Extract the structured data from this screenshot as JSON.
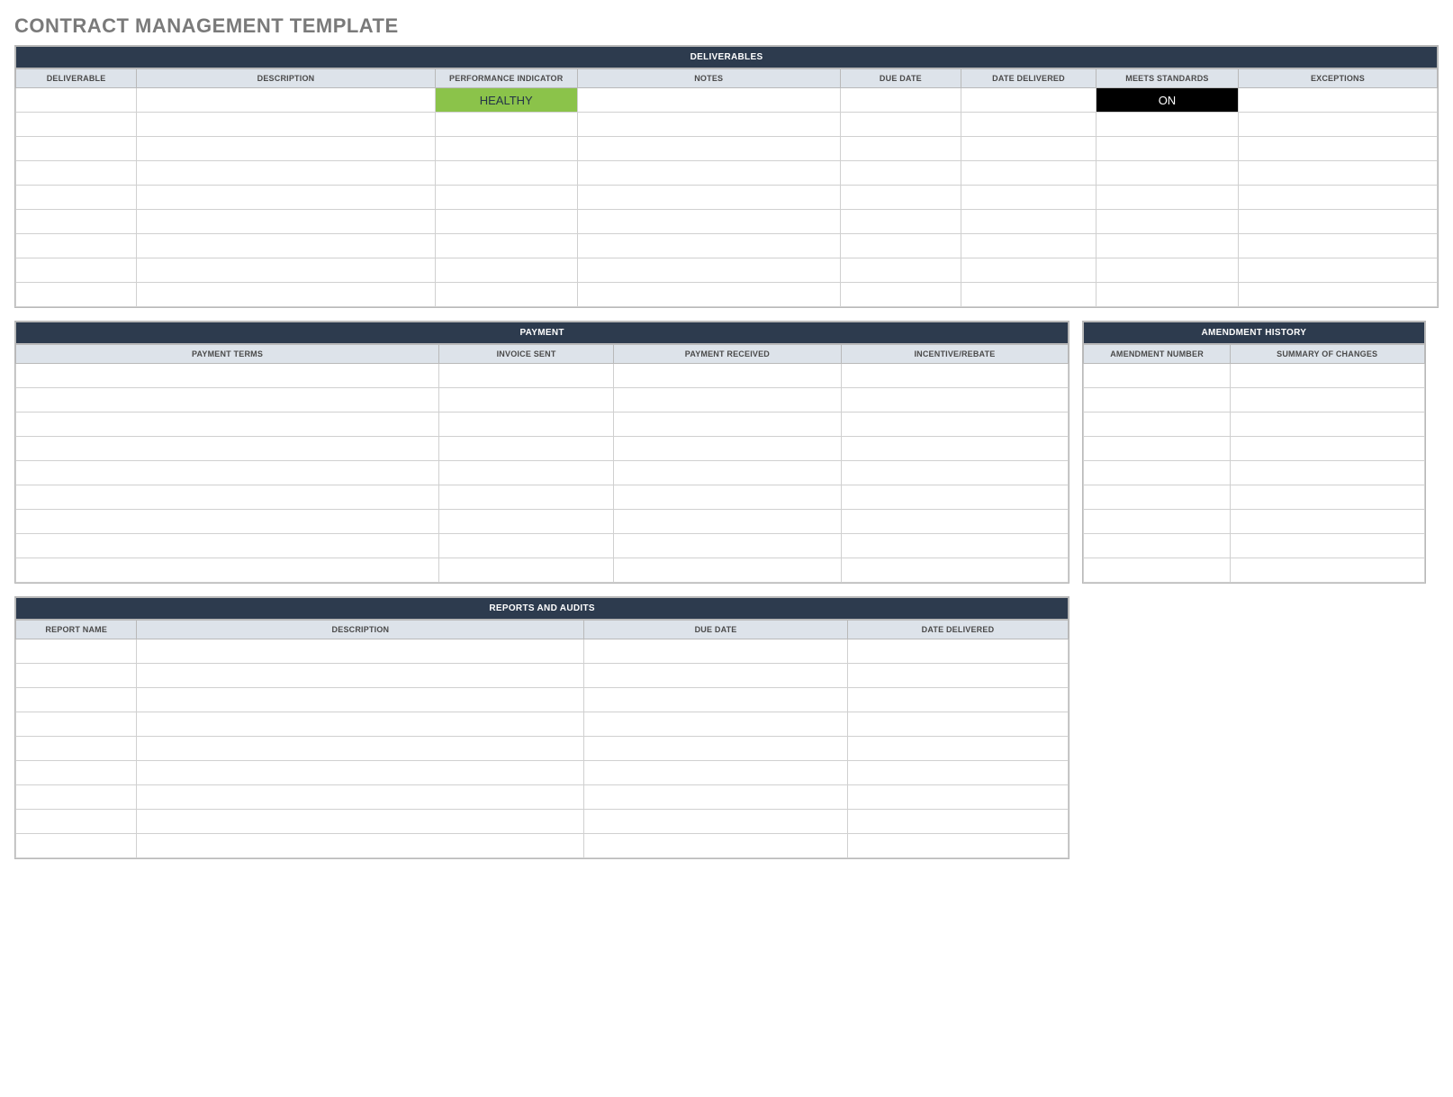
{
  "title": "CONTRACT MANAGEMENT TEMPLATE",
  "deliverables": {
    "section_title": "DELIVERABLES",
    "headers": [
      "DELIVERABLE",
      "DESCRIPTION",
      "PERFORMANCE INDICATOR",
      "NOTES",
      "DUE DATE",
      "DATE DELIVERED",
      "MEETS STANDARDS",
      "EXCEPTIONS"
    ],
    "rows": [
      {
        "performance_indicator": "HEALTHY",
        "meets_standards": "ON"
      },
      {},
      {},
      {},
      {},
      {},
      {},
      {},
      {}
    ]
  },
  "payment": {
    "section_title": "PAYMENT",
    "headers": [
      "PAYMENT TERMS",
      "INVOICE SENT",
      "PAYMENT RECEIVED",
      "INCENTIVE/REBATE"
    ],
    "row_count": 9
  },
  "amendment": {
    "section_title": "AMENDMENT HISTORY",
    "headers": [
      "AMENDMENT NUMBER",
      "SUMMARY OF CHANGES"
    ],
    "row_count": 9
  },
  "reports": {
    "section_title": "REPORTS AND AUDITS",
    "headers": [
      "REPORT NAME",
      "DESCRIPTION",
      "DUE DATE",
      "DATE DELIVERED"
    ],
    "row_count": 9
  }
}
